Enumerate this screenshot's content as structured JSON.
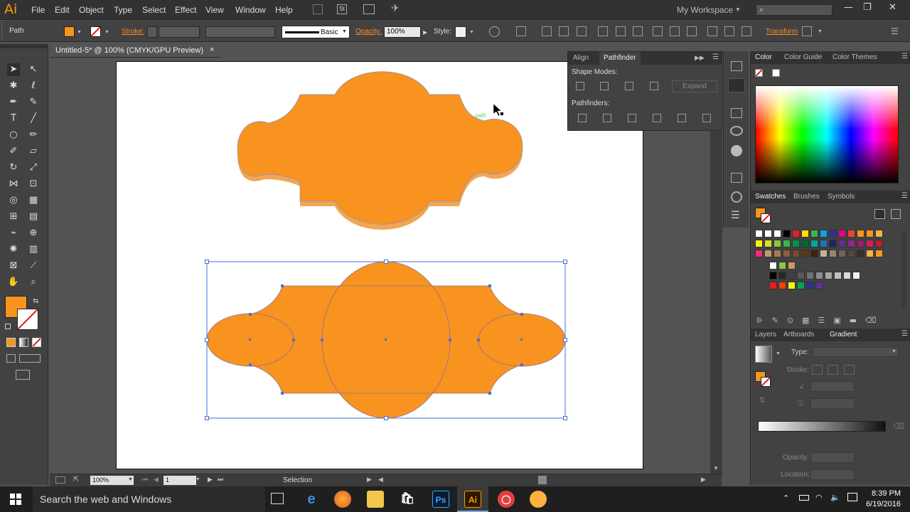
{
  "app": {
    "logo": "Ai",
    "workspace": "My Workspace"
  },
  "menu": [
    "File",
    "Edit",
    "Object",
    "Type",
    "Select",
    "Effect",
    "View",
    "Window",
    "Help"
  ],
  "control": {
    "object_type": "Path",
    "stroke_label": "Stroke:",
    "brush_label": "Basic",
    "opacity_label": "Opacity:",
    "opacity_value": "100%",
    "style_label": "Style:",
    "transform_label": "Transform",
    "fill_color": "#f7931e"
  },
  "document": {
    "tab_title": "Untitled-5* @ 100% (CMYK/GPU Preview)",
    "close": "×"
  },
  "canvas": {
    "smart_guide_label": "path",
    "shape_color": "#f7931e",
    "selection_color": "#4a6fd4"
  },
  "status": {
    "zoom": "100%",
    "artboard": "1",
    "tool": "Selection"
  },
  "pathfinder": {
    "tabs": [
      "Align",
      "Pathfinder"
    ],
    "shape_modes": "Shape Modes:",
    "expand": "Expand",
    "pathfinders": "Pathfinders:"
  },
  "color_panel": {
    "tabs": [
      "Color",
      "Color Guide",
      "Color Themes"
    ]
  },
  "swatches_panel": {
    "tabs": [
      "Swatches",
      "Brushes",
      "Symbols"
    ]
  },
  "gradient_panel": {
    "tabs": [
      "Layers",
      "Artboards",
      "Gradient"
    ],
    "type_label": "Type:",
    "stroke_label": "Stroke:",
    "opacity_label": "Opacity:",
    "location_label": "Location:"
  },
  "taskbar": {
    "search": "Search the web and Windows",
    "time": "8:39 PM",
    "date": "6/19/2016",
    "ps": "Ps",
    "ai": "Ai"
  }
}
